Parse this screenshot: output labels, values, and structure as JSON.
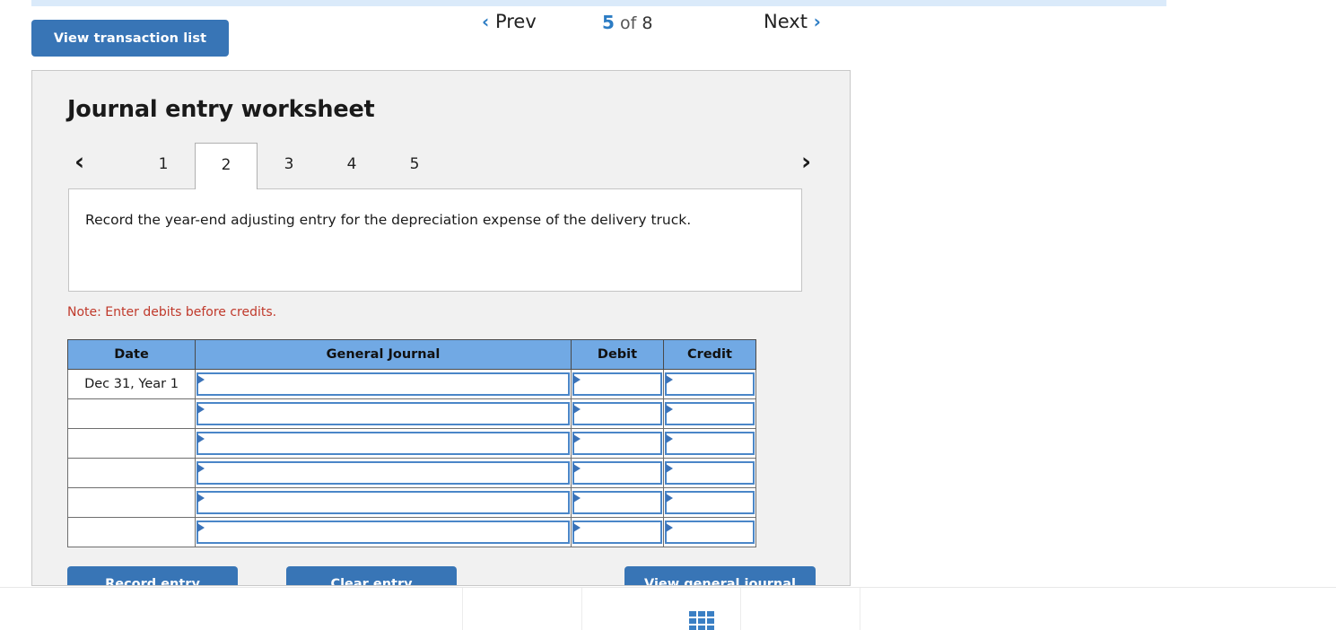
{
  "toolbar": {
    "view_transaction_list_label": "View transaction list"
  },
  "worksheet": {
    "title": "Journal entry worksheet",
    "prev_icon": "‹",
    "next_icon": "›",
    "tabs": [
      {
        "label": "1",
        "active": false
      },
      {
        "label": "2",
        "active": true
      },
      {
        "label": "3",
        "active": false
      },
      {
        "label": "4",
        "active": false
      },
      {
        "label": "5",
        "active": false
      }
    ],
    "instruction": "Record the year-end adjusting entry for the depreciation expense of the delivery truck.",
    "note": "Note: Enter debits before credits."
  },
  "journal_table": {
    "headers": [
      "Date",
      "General Journal",
      "Debit",
      "Credit"
    ],
    "rows": [
      {
        "date": "Dec 31, Year 1",
        "general_journal": "",
        "debit": "",
        "credit": ""
      },
      {
        "date": "",
        "general_journal": "",
        "debit": "",
        "credit": ""
      },
      {
        "date": "",
        "general_journal": "",
        "debit": "",
        "credit": ""
      },
      {
        "date": "",
        "general_journal": "",
        "debit": "",
        "credit": ""
      },
      {
        "date": "",
        "general_journal": "",
        "debit": "",
        "credit": ""
      },
      {
        "date": "",
        "general_journal": "",
        "debit": "",
        "credit": ""
      }
    ]
  },
  "actions": {
    "record_label": "Record entry",
    "clear_label": "Clear entry",
    "view_journal_label": "View general journal"
  },
  "footer": {
    "prev_label": "Prev",
    "next_label": "Next",
    "prev_icon": "‹",
    "next_icon": "›",
    "current_page": "5",
    "of_label": "of",
    "total_pages": "8",
    "grid_icon": "grid-icon"
  },
  "colors": {
    "accent_blue": "#3875b6",
    "header_blue": "#71a9e4",
    "input_border_blue": "#4a86c8",
    "note_red": "#c0392b",
    "panel_bg": "#f1f1f1",
    "top_strip": "#daeafa"
  }
}
